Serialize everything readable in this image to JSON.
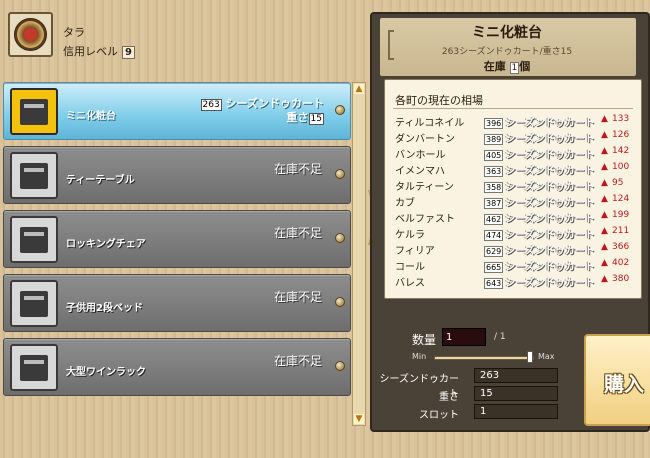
{
  "merchant": {
    "name": "タラ",
    "level_label": "信用レベル",
    "level": "9"
  },
  "items": [
    {
      "name": "ミニ化粧台",
      "price": "263",
      "currency": "シーズンドゥカート",
      "weight_label": "重さ",
      "weight": "15",
      "selected": true,
      "icon": "dresser-icon"
    },
    {
      "name": "ティーテーブル",
      "stock_status": "在庫不足",
      "icon": "tea-table-icon"
    },
    {
      "name": "ロッキングチェア",
      "stock_status": "在庫不足",
      "icon": "rocking-chair-icon"
    },
    {
      "name": "子供用2段ベッド",
      "stock_status": "在庫不足",
      "icon": "bunk-bed-icon"
    },
    {
      "name": "大型ワインラック",
      "stock_status": "在庫不足",
      "icon": "wine-rack-icon"
    }
  ],
  "detail": {
    "title": "ミニ化粧台",
    "subtitle": "263シーズンドゥカート/重さ15",
    "stock_label": "在庫",
    "stock_count": "1",
    "stock_unit": "個"
  },
  "market": {
    "title": "各町の現在の相場",
    "currency": "シーズンドゥカート",
    "rows": [
      {
        "town": "ティルコネイル",
        "price": "396",
        "diff": "133"
      },
      {
        "town": "ダンバートン",
        "price": "389",
        "diff": "126"
      },
      {
        "town": "バンホール",
        "price": "405",
        "diff": "142"
      },
      {
        "town": "イメンマハ",
        "price": "363",
        "diff": "100"
      },
      {
        "town": "タルティーン",
        "price": "358",
        "diff": "95"
      },
      {
        "town": "カブ",
        "price": "387",
        "diff": "124"
      },
      {
        "town": "ベルファスト",
        "price": "462",
        "diff": "199"
      },
      {
        "town": "ケルラ",
        "price": "474",
        "diff": "211"
      },
      {
        "town": "フィリア",
        "price": "629",
        "diff": "366"
      },
      {
        "town": "コール",
        "price": "665",
        "diff": "402"
      },
      {
        "town": "バレス",
        "price": "643",
        "diff": "380"
      }
    ]
  },
  "purchase": {
    "qty_label": "数量",
    "qty": "1",
    "qty_max": "/ 1",
    "min_label": "Min",
    "max_label": "Max",
    "currency_label": "シーズンドゥカート",
    "currency_value": "263",
    "weight_label": "重さ",
    "weight_value": "15",
    "slot_label": "スロット",
    "slot_value": "1",
    "buy_label": "購入",
    "slider_fraction": 1.0
  },
  "colors": {
    "selected": "#7fcde9",
    "diff_up": "#c01818",
    "buy_button": "#f0d080"
  }
}
